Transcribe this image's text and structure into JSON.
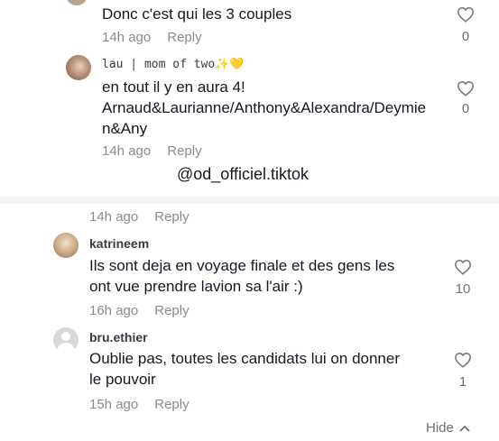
{
  "watermark": "@od_officiel.tiktok",
  "comments": [
    {
      "username": "",
      "lines": [
        "Donc c'est qui les 3 couples"
      ],
      "time": "14h ago",
      "reply": "Reply",
      "likes": "0"
    },
    {
      "username": "lau | mom of two",
      "username_emoji": "✨💛",
      "lines": [
        "en tout il y en aura 4!",
        "Arnaud&Laurianne/Anthony&Alexandra/Deymie",
        "n&Any"
      ],
      "time": "14h ago",
      "reply": "Reply",
      "likes": "0"
    },
    {
      "username": "",
      "lines": [],
      "time": "14h ago",
      "reply": "Reply",
      "likes": ""
    },
    {
      "username": "katrineem",
      "lines": [
        "Ils sont deja en voyage finale et des gens les",
        "ont vue prendre lavion sa l'air :)"
      ],
      "time": "16h ago",
      "reply": "Reply",
      "likes": "10"
    },
    {
      "username": "bru.ethier",
      "lines": [
        "Oublie pas, toutes les candidats lui on donner",
        "le pouvoir"
      ],
      "time": "15h ago",
      "reply": "Reply",
      "likes": "1"
    }
  ],
  "footer": {
    "hide_label": "Hide"
  },
  "icons": {
    "like": "heart-outline-icon",
    "hide": "chevron-up-icon",
    "default_avatar": "default-avatar-icon"
  }
}
